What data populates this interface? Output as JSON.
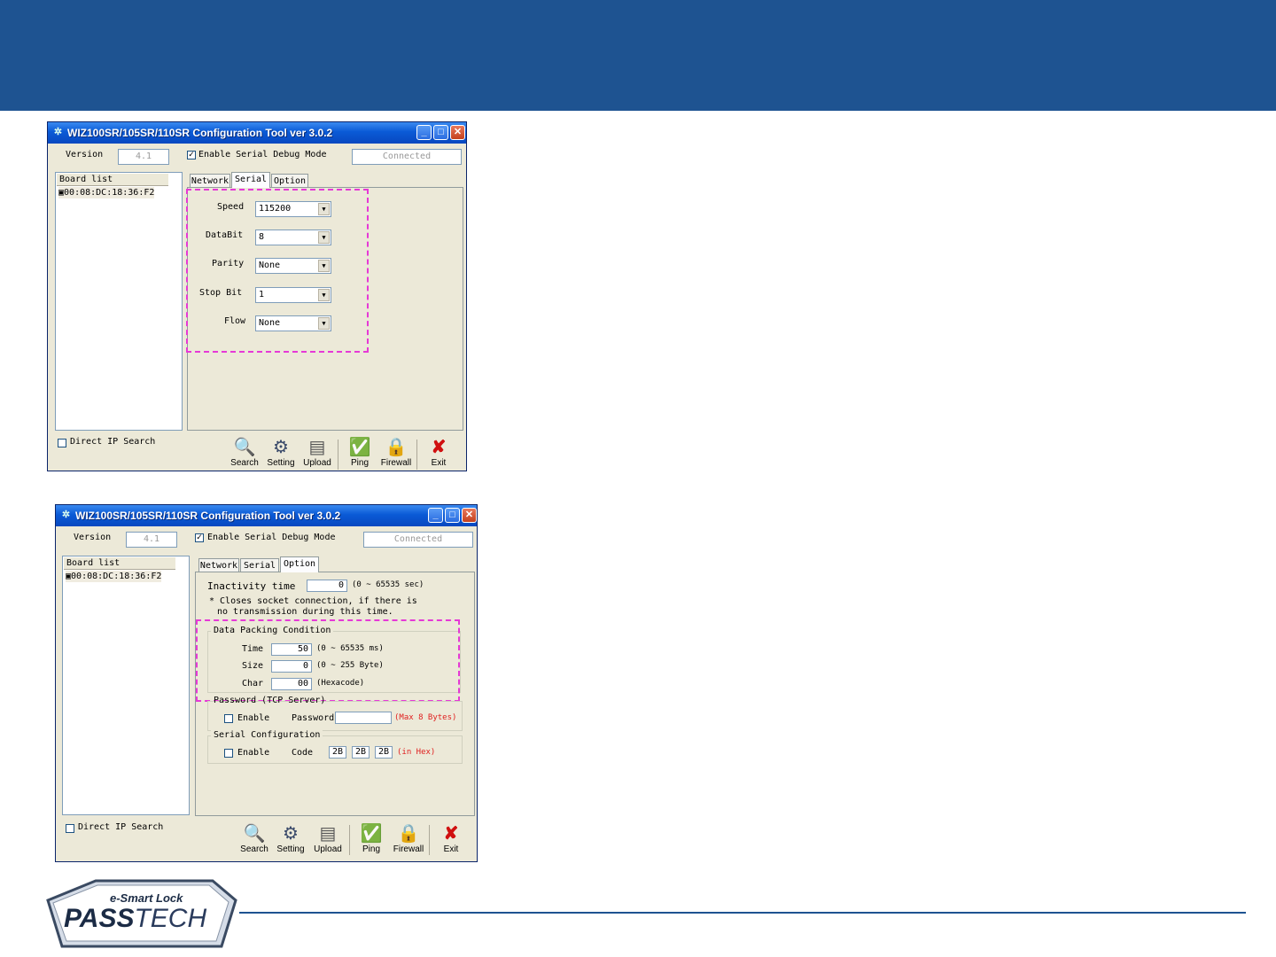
{
  "window_title": "WIZ100SR/105SR/110SR Configuration Tool ver 3.0.2",
  "common": {
    "version_label": "Version",
    "version_value": "4.1",
    "debug_label": "Enable Serial Debug Mode",
    "status_value": "Connected",
    "board_list_header": "Board list",
    "board_item": "00:08:DC:18:36:F2",
    "direct_ip_label": "Direct IP Search",
    "tabs": [
      "Network",
      "Serial",
      "Option"
    ],
    "toolbar": [
      "Search",
      "Setting",
      "Upload",
      "Ping",
      "Firewall",
      "Exit"
    ]
  },
  "serial_tab": {
    "fields": [
      {
        "label": "Speed",
        "value": "115200"
      },
      {
        "label": "DataBit",
        "value": "8"
      },
      {
        "label": "Parity",
        "value": "None"
      },
      {
        "label": "Stop Bit",
        "value": "1"
      },
      {
        "label": "Flow",
        "value": "None"
      }
    ]
  },
  "option_tab": {
    "inactivity_label": "Inactivity time",
    "inactivity_value": "0",
    "inactivity_range": "(0 ~ 65535 sec)",
    "note_line1": "* Closes socket connection, if there is",
    "note_line2": "no transmission during this time.",
    "packing_title": "Data Packing Condition",
    "time_label": "Time",
    "time_value": "50",
    "time_range": "(0 ~ 65535 ms)",
    "size_label": "Size",
    "size_value": "0",
    "size_range": "(0 ~ 255 Byte)",
    "char_label": "Char",
    "char_value": "00",
    "char_range": "(Hexacode)",
    "password_title": "Password (TCP Server)",
    "enable_label": "Enable",
    "password_label": "Password",
    "password_hint": "(Max 8 Bytes)",
    "serial_cfg_title": "Serial Configuration",
    "code_label": "Code",
    "code_values": [
      "2B",
      "2B",
      "2B"
    ],
    "code_hint": "(in Hex)"
  },
  "logo": {
    "line1": "e-Smart Lock",
    "pass": "PASS",
    "tech": "TECH"
  },
  "colors": {
    "header": "#1e5391",
    "highlight": "#e639d6",
    "window_bg": "#ece9d8",
    "titlebar": "#0a5ad6"
  }
}
